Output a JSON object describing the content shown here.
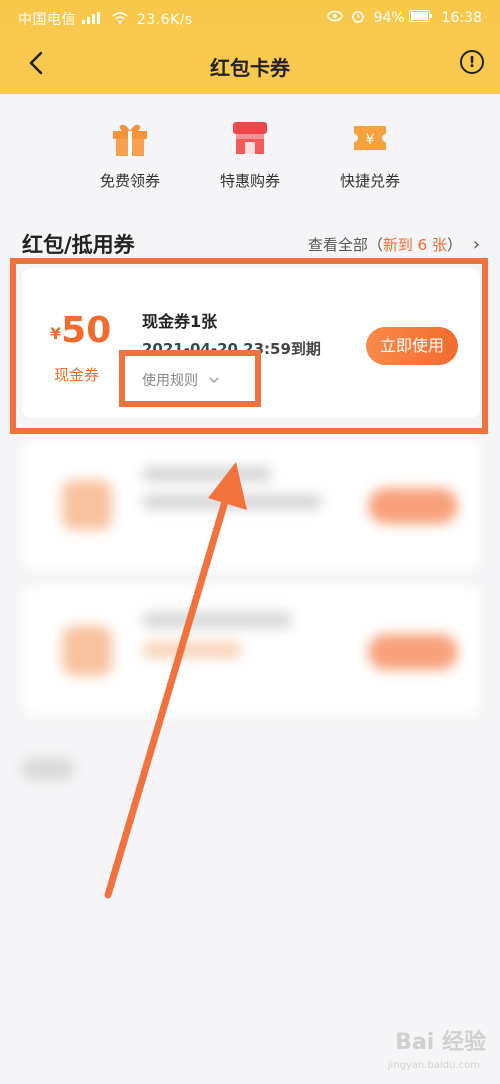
{
  "status_bar": {
    "carrier": "中国电信",
    "network_speed": "23.6K/s",
    "battery": "94%",
    "time": "16:38"
  },
  "header": {
    "title": "红包卡券"
  },
  "quick_actions": [
    {
      "label": "免费领券",
      "icon": "gift-icon"
    },
    {
      "label": "特惠购券",
      "icon": "store-icon"
    },
    {
      "label": "快捷兑券",
      "icon": "ticket-yen-icon"
    }
  ],
  "section": {
    "title": "红包/抵用券",
    "view_all": "查看全部（",
    "new_count": "新到 6 张",
    "view_all_close": "）",
    "chevron": "›"
  },
  "coupon": {
    "currency": "¥",
    "amount": "50",
    "type": "现金券",
    "name": "现金券1张",
    "expiry": "2021-04-20 23:59到期",
    "rules_label": "使用规则",
    "use_button": "立即使用"
  },
  "colors": {
    "accent": "#f36b2f",
    "header_bg": "#f9c94f",
    "annotation": "#f2723d"
  },
  "watermark": {
    "text": "Bai 经验",
    "sub": "jingyan.baidu.com"
  }
}
